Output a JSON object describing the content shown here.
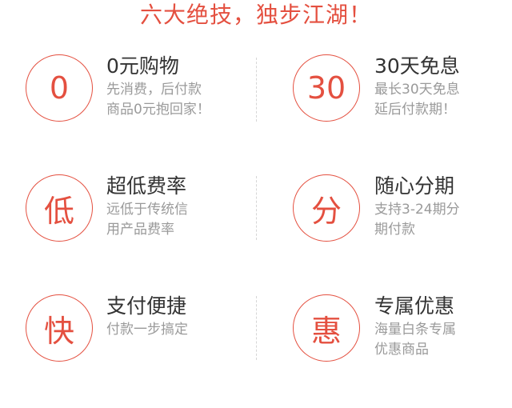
{
  "title": "六大绝技，独步江湖！",
  "features": [
    {
      "icon": "0",
      "heading": "0元购物",
      "desc_line1": "先消费，后付款",
      "desc_line2": "商品0元抱回家！"
    },
    {
      "icon": "30",
      "heading": "30天免息",
      "desc_line1": "最长30天免息",
      "desc_line2": "延后付款期！"
    },
    {
      "icon": "低",
      "heading": "超低费率",
      "desc_line1": "远低于传统信",
      "desc_line2": "用产品费率"
    },
    {
      "icon": "分",
      "heading": "随心分期",
      "desc_line1": "支持3-24期分",
      "desc_line2": "期付款"
    },
    {
      "icon": "快",
      "heading": "支付便捷",
      "desc_line1": "付款一步搞定",
      "desc_line2": ""
    },
    {
      "icon": "惠",
      "heading": "专属优惠",
      "desc_line1": "海量白条专属",
      "desc_line2": "优惠商品"
    }
  ],
  "colors": {
    "accent": "#e45040",
    "heading": "#333333",
    "desc": "#9a9a9a",
    "divider": "#d6d6d6"
  }
}
